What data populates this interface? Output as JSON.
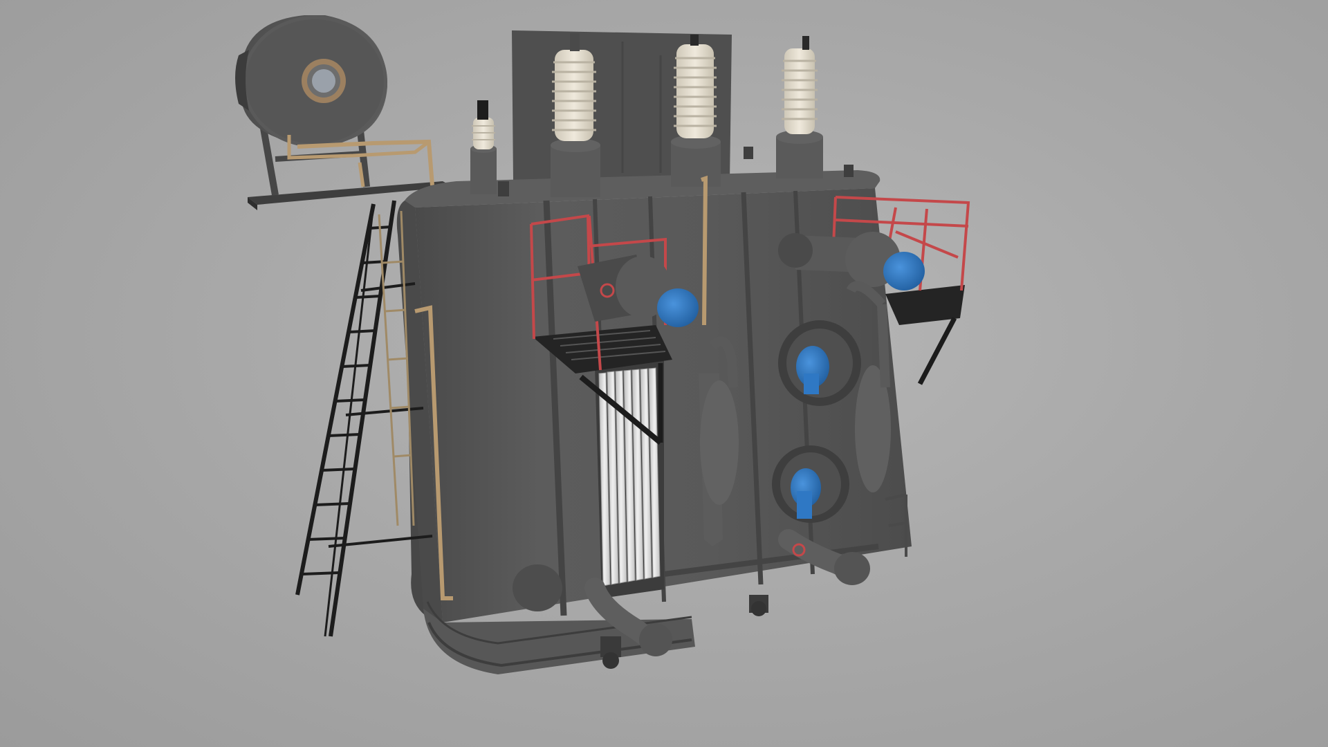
{
  "scene": {
    "subject": "power-transformer-3d-model",
    "background_color": "#a8a8a8",
    "colors": {
      "tank": "#565656",
      "tank_dark": "#444444",
      "tank_light": "#6a6a6a",
      "bushing_porcelain": "#e2dccd",
      "railing": "#c4484a",
      "ladder": "#1c1c1c",
      "pipe_brass": "#b89a70",
      "fan_blue": "#2f78c4",
      "radiator_fins": "#d8d8d8"
    }
  }
}
